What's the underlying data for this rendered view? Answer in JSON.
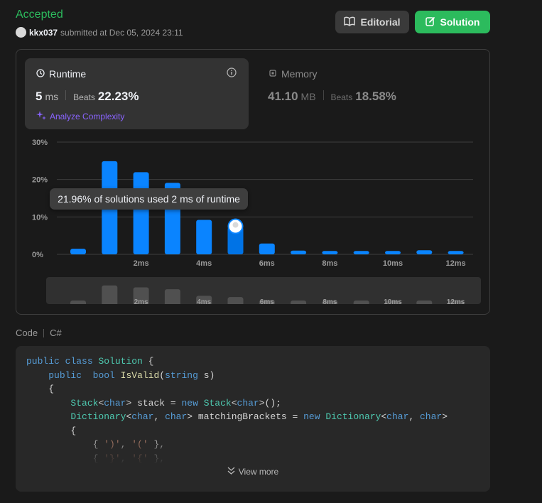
{
  "header": {
    "status": "Accepted",
    "username": "kkx037",
    "submitted_text": "submitted at Dec 05, 2024 23:11",
    "editorial_label": "Editorial",
    "solution_label": "Solution"
  },
  "runtime": {
    "title": "Runtime",
    "value": "5",
    "unit": "ms",
    "beats_label": "Beats",
    "beats_value": "22.23%",
    "analyze_label": "Analyze Complexity"
  },
  "memory": {
    "title": "Memory",
    "value": "41.10",
    "unit": "MB",
    "beats_label": "Beats",
    "beats_value": "18.58%"
  },
  "tooltip": "21.96% of solutions used 2 ms of runtime",
  "chart_data": {
    "type": "bar",
    "categories": [
      "0ms",
      "1ms",
      "2ms",
      "3ms",
      "4ms",
      "5ms",
      "6ms",
      "7ms",
      "8ms",
      "9ms",
      "10ms",
      "11ms",
      "12ms"
    ],
    "values": [
      1.5,
      24.9,
      21.96,
      19.1,
      9.2,
      7.3,
      2.9,
      1.0,
      0.9,
      0.9,
      0.9,
      1.1,
      0.9
    ],
    "highlight_index": 5,
    "ylim": [
      0,
      30
    ],
    "yticks": [
      "30%",
      "20%",
      "10%",
      "0%"
    ],
    "xticks": [
      "2ms",
      "4ms",
      "6ms",
      "8ms",
      "10ms",
      "12ms"
    ],
    "grid": true,
    "bar_color": "#0a84ff",
    "highlight_color": "#0073e6"
  },
  "code": {
    "label": "Code",
    "language": "C#",
    "view_more": "View more",
    "lines": [
      "public class Solution {",
      "    public  bool IsValid(string s)",
      "    {",
      "        Stack<char> stack = new Stack<char>();",
      "        Dictionary<char, char> matchingBrackets = new Dictionary<char, char>",
      "        {",
      "            { ')', '(' },",
      "            { '}', '{' },"
    ]
  },
  "colors": {
    "accepted": "#2cbb5d",
    "accent_purple": "#8a64ff",
    "bar_blue": "#0a84ff"
  }
}
